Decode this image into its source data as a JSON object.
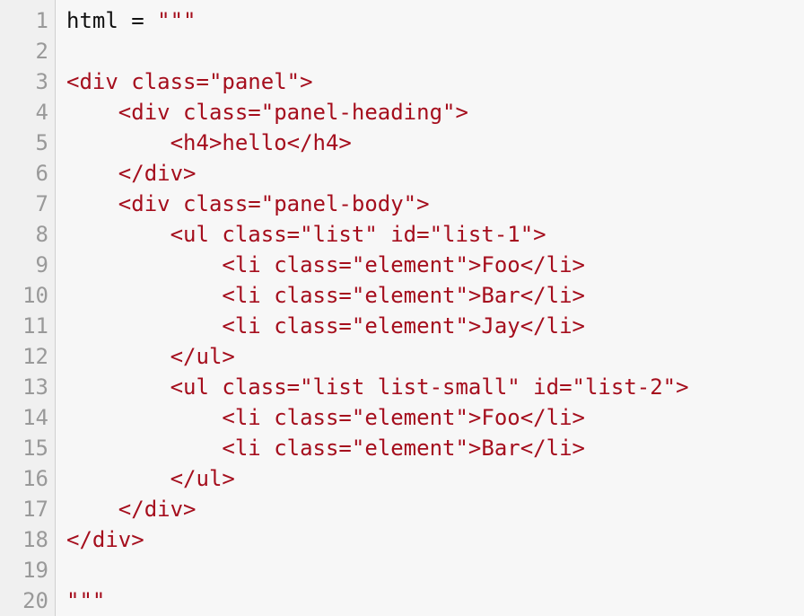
{
  "editor": {
    "colors": {
      "string": "#a50e1d",
      "text": "#111111",
      "line_number": "#999999",
      "background": "#f7f7f7",
      "gutter": "#f0f0f0"
    },
    "lines": [
      {
        "number": "1",
        "code": "",
        "prefix": "html = ",
        "string": "\"\"\""
      },
      {
        "number": "2",
        "prefix": "",
        "string": ""
      },
      {
        "number": "3",
        "prefix": "",
        "string": "<div class=\"panel\">"
      },
      {
        "number": "4",
        "prefix": "",
        "string": "    <div class=\"panel-heading\">"
      },
      {
        "number": "5",
        "prefix": "",
        "string": "        <h4>hello</h4>"
      },
      {
        "number": "6",
        "prefix": "",
        "string": "    </div>"
      },
      {
        "number": "7",
        "prefix": "",
        "string": "    <div class=\"panel-body\">"
      },
      {
        "number": "8",
        "prefix": "",
        "string": "        <ul class=\"list\" id=\"list-1\">"
      },
      {
        "number": "9",
        "prefix": "",
        "string": "            <li class=\"element\">Foo</li>"
      },
      {
        "number": "10",
        "prefix": "",
        "string": "            <li class=\"element\">Bar</li>"
      },
      {
        "number": "11",
        "prefix": "",
        "string": "            <li class=\"element\">Jay</li>"
      },
      {
        "number": "12",
        "prefix": "",
        "string": "        </ul>"
      },
      {
        "number": "13",
        "prefix": "",
        "string": "        <ul class=\"list list-small\" id=\"list-2\">"
      },
      {
        "number": "14",
        "prefix": "",
        "string": "            <li class=\"element\">Foo</li>"
      },
      {
        "number": "15",
        "prefix": "",
        "string": "            <li class=\"element\">Bar</li>"
      },
      {
        "number": "16",
        "prefix": "",
        "string": "        </ul>"
      },
      {
        "number": "17",
        "prefix": "",
        "string": "    </div>"
      },
      {
        "number": "18",
        "prefix": "",
        "string": "</div>"
      },
      {
        "number": "19",
        "prefix": "",
        "string": ""
      },
      {
        "number": "20",
        "prefix": "",
        "string": "\"\"\""
      }
    ]
  }
}
